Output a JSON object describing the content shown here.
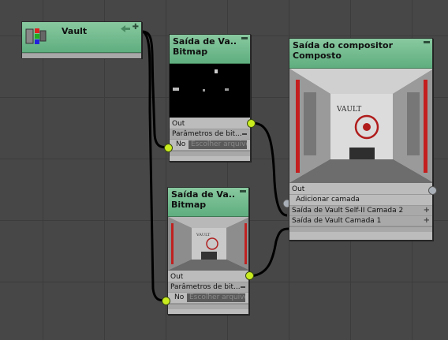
{
  "vault_node": {
    "title": "Vault",
    "add_symbol": "✚"
  },
  "bitmap1": {
    "title": "Saída de Va...",
    "subtitle": "Bitmap",
    "out_label": "Out",
    "params_label": "Parâmetros de bit...",
    "no_label": "No",
    "choose_placeholder": "Escolher arquivo"
  },
  "bitmap2": {
    "title": "Saída de Va...",
    "subtitle": "Bitmap",
    "out_label": "Out",
    "params_label": "Parâmetros de bit...",
    "no_label": "No",
    "choose_placeholder": "Escolher arquivo"
  },
  "compositor": {
    "title": "Saída do compositor",
    "subtitle": "Composto",
    "out_label": "Out",
    "add_layer_label": "Adicionar camada",
    "layer2_label": "Saída de Vault Self-II Camada 2",
    "layer1_label": "Saída de Vault Camada 1",
    "preview_sign": "VAULT"
  },
  "colors": {
    "header_green": "#6fb98c",
    "port_yellow": "#c8ec1e",
    "canvas": "#474747",
    "wire": "#000000"
  }
}
